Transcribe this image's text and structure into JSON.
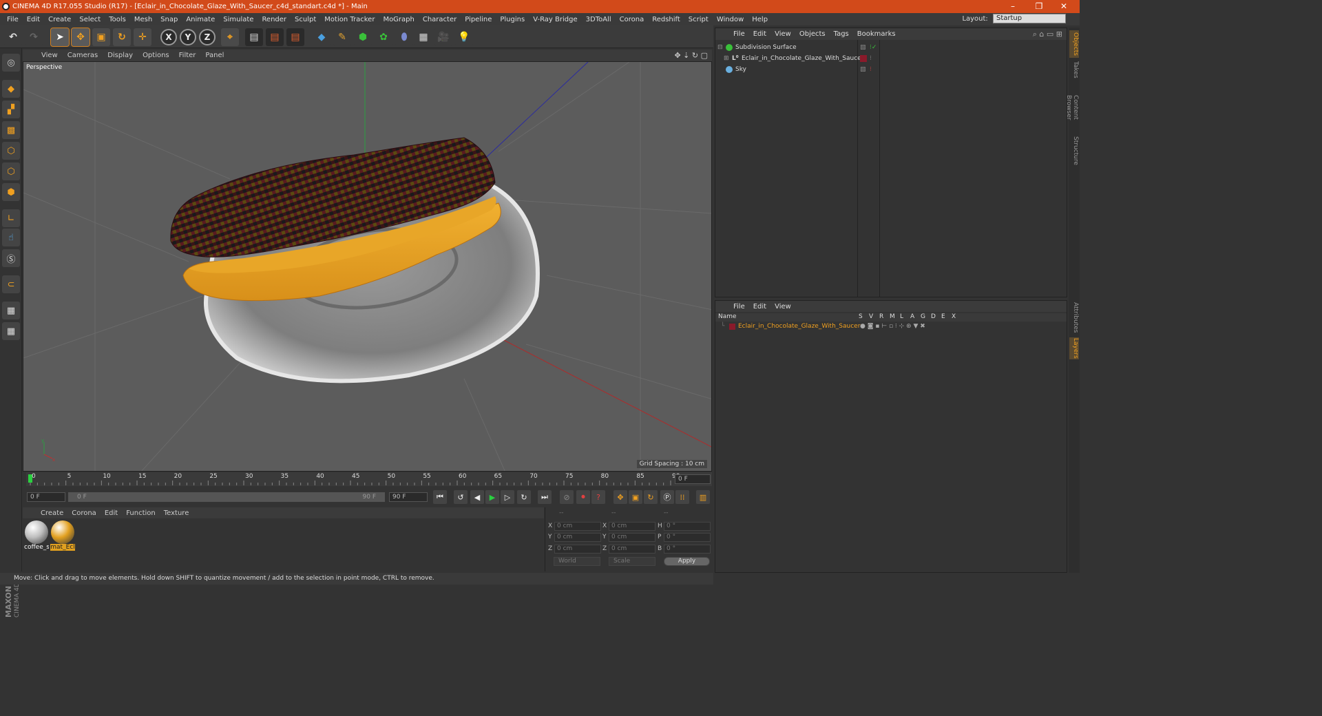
{
  "window": {
    "title": "CINEMA 4D R17.055 Studio (R17) - [Eclair_in_Chocolate_Glaze_With_Saucer_c4d_standart.c4d *] - Main",
    "minimize": "–",
    "restore": "❐",
    "close": "✕"
  },
  "menu": [
    "File",
    "Edit",
    "Create",
    "Select",
    "Tools",
    "Mesh",
    "Snap",
    "Animate",
    "Simulate",
    "Render",
    "Sculpt",
    "Motion Tracker",
    "MoGraph",
    "Character",
    "Pipeline",
    "Plugins",
    "V-Ray Bridge",
    "3DToAll",
    "Corona",
    "Redshift",
    "Script",
    "Window",
    "Help"
  ],
  "layout": {
    "label": "Layout:",
    "value": "Startup"
  },
  "toolbar": {
    "axis_x": "X",
    "axis_y": "Y",
    "axis_z": "Z"
  },
  "viewport": {
    "menu": [
      "View",
      "Cameras",
      "Display",
      "Options",
      "Filter",
      "Panel"
    ],
    "label": "Perspective",
    "grid_spacing": "Grid Spacing : 10 cm"
  },
  "timeline": {
    "ticks": [
      "0",
      "5",
      "10",
      "15",
      "20",
      "25",
      "30",
      "35",
      "40",
      "45",
      "50",
      "55",
      "60",
      "65",
      "70",
      "75",
      "80",
      "85",
      "90"
    ],
    "current_frame": "0 F"
  },
  "transport": {
    "start_field": "0 F",
    "range_start": "0 F",
    "range_end": "90 F",
    "end_field": "90 F"
  },
  "materials": {
    "menu": [
      "Create",
      "Corona",
      "Edit",
      "Function",
      "Texture"
    ],
    "items": [
      {
        "label": "coffee_s",
        "color": "#bdbdbd"
      },
      {
        "label": "mat_Ecl",
        "color": "#e2a020"
      }
    ]
  },
  "coords": {
    "headers": [
      "--",
      "--",
      "--"
    ],
    "rows": [
      {
        "l1": "X",
        "v1": "0 cm",
        "l2": "X",
        "v2": "0 cm",
        "l3": "H",
        "v3": "0 °"
      },
      {
        "l1": "Y",
        "v1": "0 cm",
        "l2": "Y",
        "v2": "0 cm",
        "l3": "P",
        "v3": "0 °"
      },
      {
        "l1": "Z",
        "v1": "0 cm",
        "l2": "Z",
        "v2": "0 cm",
        "l3": "B",
        "v3": "0 °"
      }
    ],
    "space": "World",
    "mode": "Scale",
    "apply": "Apply"
  },
  "status": "Move: Click and drag to move elements. Hold down SHIFT to quantize movement / add to the selection in point mode, CTRL to remove.",
  "objects": {
    "menu": [
      "File",
      "Edit",
      "View",
      "Objects",
      "Tags",
      "Bookmarks"
    ],
    "items": [
      {
        "name": "Subdivision Surface",
        "color": "#3ac03a"
      },
      {
        "name": "Eclair_in_Chocolate_Glaze_With_Saucer",
        "color": "#9a9a9a"
      },
      {
        "name": "Sky",
        "color": "#6ab0e0"
      }
    ]
  },
  "layers": {
    "menu": [
      "File",
      "Edit",
      "View"
    ],
    "header_name": "Name",
    "columns": [
      "S",
      "V",
      "R",
      "M",
      "L",
      "A",
      "G",
      "D",
      "E",
      "X"
    ],
    "items": [
      {
        "name": "Eclair_in_Chocolate_Glaze_With_Saucer",
        "color": "#8a1a2a"
      }
    ]
  },
  "right_tabs": [
    "Objects",
    "Takes",
    "Content Browser",
    "Structure",
    "Attributes",
    "Layers"
  ],
  "brand": {
    "line1": "MAXON",
    "line2": "CINEMA 4D"
  }
}
